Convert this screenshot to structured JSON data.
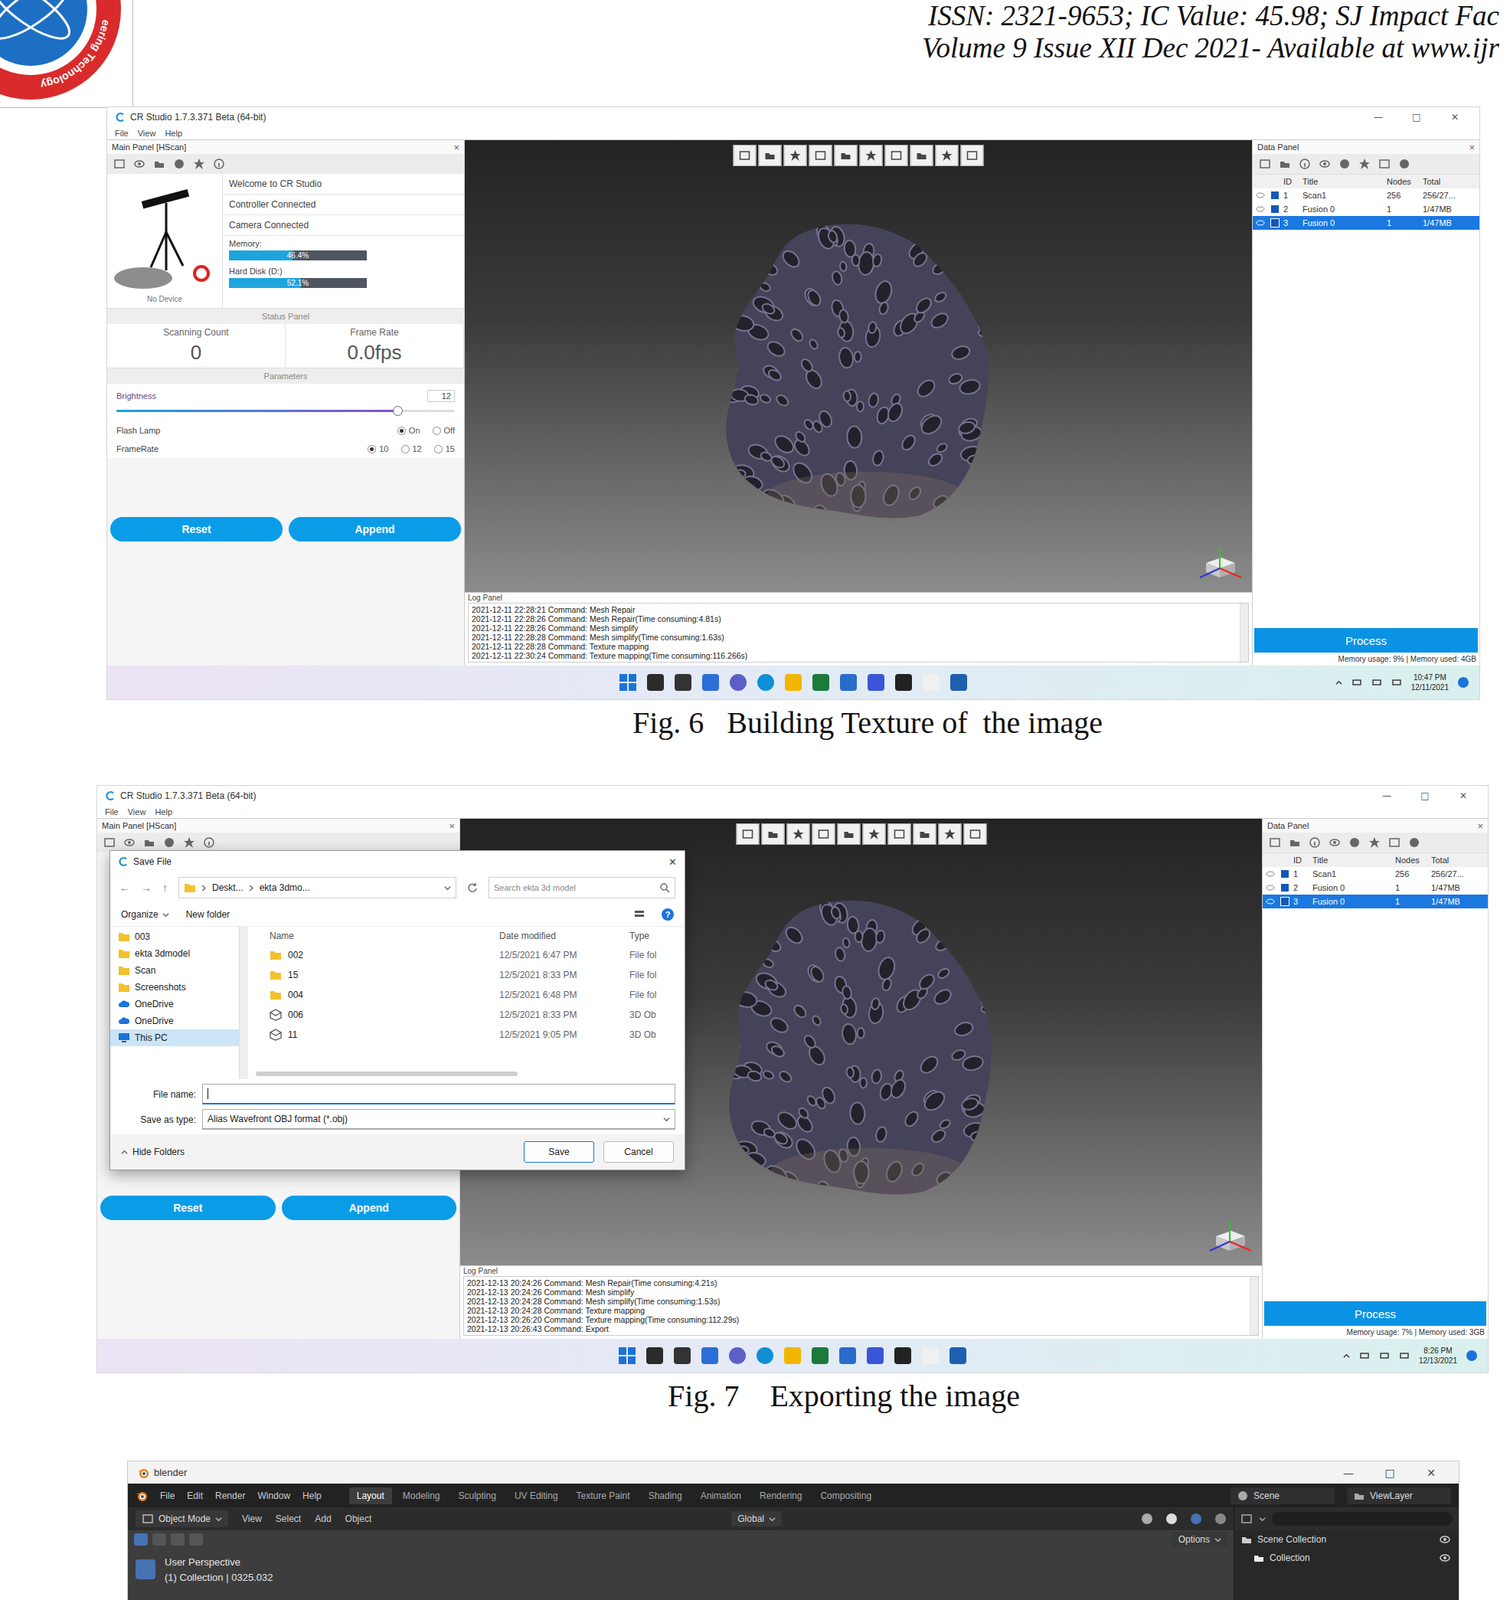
{
  "header": {
    "logo": {
      "text": "eering Technology"
    },
    "lines": [
      "ISSN: 2321-9653; IC Value: 45.98; SJ Impact Fac",
      "Volume 9 Issue XII Dec 2021- Available at www.ijr"
    ]
  },
  "figures": [
    {
      "kind": "scan",
      "caption": "Fig. 6   Building Texture of  the image",
      "window": {
        "title": "CR Studio 1.7.3.371 Beta (64-bit)",
        "controls": [
          "—",
          "□",
          "✕"
        ],
        "menu": [
          "File",
          "View",
          "Help"
        ],
        "left": {
          "title": "Main Panel [HScan]",
          "close": "×",
          "device_label": "No Device",
          "info": [
            "Welcome to CR Studio",
            "Controller Connected",
            "Camera Connected"
          ],
          "meters": [
            {
              "label": "Memory:",
              "level": 0.46,
              "reading": "46.4%"
            },
            {
              "label": "Hard Disk (D:)",
              "level": 0.52,
              "reading": "52.1%"
            }
          ],
          "status_title": "Status Panel",
          "stats": [
            {
              "label": "Scanning Count",
              "value": "0"
            },
            {
              "label": "Frame Rate",
              "value": "0.0fps"
            }
          ],
          "params_title": "Parameters",
          "brightness": {
            "label": "Brightness",
            "value": "12",
            "level": 0.83
          },
          "radios": [
            {
              "label": "Flash Lamp",
              "options": [
                {
                  "label": "On",
                  "selected": true
                },
                {
                  "label": "Off",
                  "selected": false
                }
              ]
            },
            {
              "label": "FrameRate",
              "options": [
                {
                  "label": "10",
                  "selected": true
                },
                {
                  "label": "12",
                  "selected": false
                },
                {
                  "label": "15",
                  "selected": false
                }
              ]
            }
          ],
          "buttons": [
            "Reset",
            "Append"
          ]
        },
        "log": {
          "title": "Log Panel",
          "lines": [
            "2021-12-11 22:28:21 Command: Mesh Repair",
            "2021-12-11 22:28:26 Command: Mesh Repair(Time consuming:4.81s)",
            "2021-12-11 22:28:26 Command: Mesh simplify",
            "2021-12-11 22:28:28 Command: Mesh simplify(Time consuming:1.63s)",
            "2021-12-11 22:28:28 Command: Texture mapping",
            "2021-12-11 22:30:24 Command: Texture mapping(Time consuming:116.266s)"
          ]
        },
        "data": {
          "title": "Data Panel",
          "close": "×",
          "columns": [
            "ID",
            "Title",
            "Nodes",
            "Total"
          ],
          "rows": [
            {
              "id": "1",
              "title": "Scan1",
              "nodes": "256",
              "total": "256/27...",
              "selected": false
            },
            {
              "id": "2",
              "title": "Fusion 0",
              "nodes": "1",
              "total": "1/47MB",
              "selected": false
            },
            {
              "id": "3",
              "title": "Fusion 0",
              "nodes": "1",
              "total": "1/47MB",
              "selected": true
            }
          ]
        },
        "process": "Process",
        "memory_status": "Memory usage: 9% | Memory used: 4GB",
        "clock": {
          "time": "10:47 PM",
          "date": "12/11/2021"
        }
      }
    },
    {
      "kind": "scan",
      "caption": "Fig. 7    Exporting the image",
      "window": {
        "title": "CR Studio 1.7.3.371 Beta (64-bit)",
        "controls": [
          "—",
          "□",
          "✕"
        ],
        "menu": [
          "File",
          "View",
          "Help"
        ],
        "left": {
          "title": "Main Panel [HScan]",
          "close": "×",
          "buttons": [
            "Reset",
            "Append"
          ]
        },
        "log": {
          "title": "Log Panel",
          "lines": [
            "2021-12-13 20:24:26 Command: Mesh Repair(Time consuming:4.21s)",
            "2021-12-13 20:24:26 Command: Mesh simplify",
            "2021-12-13 20:24:28 Command: Mesh simplify(Time consuming:1.53s)",
            "2021-12-13 20:24:28 Command: Texture mapping",
            "2021-12-13 20:26:20 Command: Texture mapping(Time consuming:112.29s)",
            "2021-12-13 20:26:43 Command: Export"
          ]
        },
        "data": {
          "title": "Data Panel",
          "close": "×",
          "columns": [
            "ID",
            "Title",
            "Nodes",
            "Total"
          ],
          "rows": [
            {
              "id": "1",
              "title": "Scan1",
              "nodes": "256",
              "total": "256/27...",
              "selected": false
            },
            {
              "id": "2",
              "title": "Fusion 0",
              "nodes": "1",
              "total": "1/47MB",
              "selected": false
            },
            {
              "id": "3",
              "title": "Fusion 0",
              "nodes": "1",
              "total": "1/47MB",
              "selected": true
            }
          ]
        },
        "process": "Process",
        "memory_status": "Memory usage: 7% | Memory used: 3GB",
        "clock": {
          "time": "8:26 PM",
          "date": "12/13/2021"
        },
        "dialog": {
          "title": "Save File",
          "close": "✕",
          "nav": [
            "←",
            "→",
            "↑"
          ],
          "path": [
            "Deskt...",
            "ekta 3dmo..."
          ],
          "search": "Search ekta 3d model",
          "organize": "Organize",
          "new_folder": "New folder",
          "help": "?",
          "tree": [
            {
              "label": "003",
              "kind": "folder",
              "selected": false
            },
            {
              "label": "ekta 3dmodel",
              "kind": "folder",
              "selected": false
            },
            {
              "label": "Scan",
              "kind": "folder",
              "selected": false
            },
            {
              "label": "Screenshots",
              "kind": "folder",
              "selected": false
            },
            {
              "label": "OneDrive",
              "kind": "cloud",
              "selected": false
            },
            {
              "label": "OneDrive",
              "kind": "cloud",
              "selected": false
            },
            {
              "label": "This PC",
              "kind": "pc",
              "selected": true
            }
          ],
          "columns": [
            "Name",
            "Date modified",
            "Type"
          ],
          "files": [
            {
              "name": "002",
              "date": "12/5/2021 6:47 PM",
              "type": "File fol",
              "kind": "folder",
              "selected": false
            },
            {
              "name": "15",
              "date": "12/5/2021 8:33 PM",
              "type": "File fol",
              "kind": "folder",
              "selected": false
            },
            {
              "name": "004",
              "date": "12/5/2021 6:48 PM",
              "type": "File fol",
              "kind": "folder",
              "selected": false
            },
            {
              "name": "006",
              "date": "12/5/2021 8:33 PM",
              "type": "3D Ob",
              "kind": "object",
              "selected": false
            },
            {
              "name": "11",
              "date": "12/5/2021 9:05 PM",
              "type": "3D Ob",
              "kind": "object",
              "selected": false
            }
          ],
          "file_name_label": "File name:",
          "file_name": "",
          "type_label": "Save as type:",
          "type": "Alias Wavefront OBJ format (*.obj)",
          "hide": "Hide Folders",
          "buttons": [
            "Save",
            "Cancel"
          ]
        }
      }
    },
    {
      "kind": "blender",
      "window": {
        "title": "blender",
        "controls": [
          "—",
          "□",
          "✕"
        ],
        "menus": [
          "File",
          "Edit",
          "Render",
          "Window",
          "Help"
        ],
        "workspaces": [
          {
            "label": "Layout",
            "selected": true
          },
          {
            "label": "Modeling",
            "selected": false
          },
          {
            "label": "Sculpting",
            "selected": false
          },
          {
            "label": "UV Editing",
            "selected": false
          },
          {
            "label": "Texture Paint",
            "selected": false
          },
          {
            "label": "Shading",
            "selected": false
          },
          {
            "label": "Animation",
            "selected": false
          },
          {
            "label": "Rendering",
            "selected": false
          },
          {
            "label": "Compositing",
            "selected": false
          }
        ],
        "scene": "Scene",
        "view_layer": "ViewLayer",
        "mode": "Object Mode",
        "view_menus": [
          "View",
          "Select",
          "Add",
          "Object"
        ],
        "transform": "Global",
        "options": "Options",
        "perspective": "User Perspective",
        "collection_info": "(1) Collection | 0325.032",
        "outliner": [
          "Scene Collection",
          "Collection"
        ]
      }
    }
  ]
}
